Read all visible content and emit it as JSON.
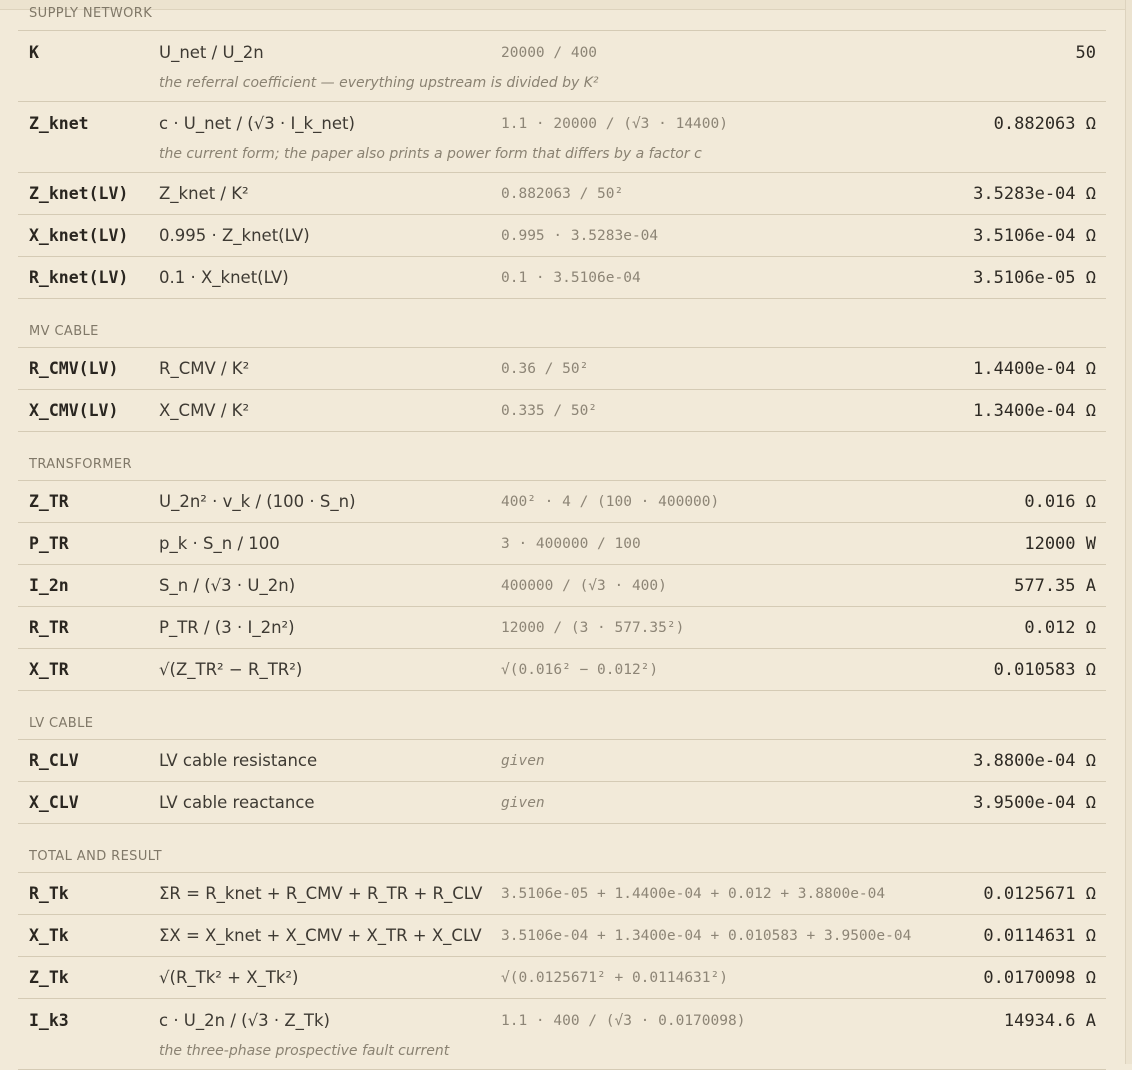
{
  "sections": {
    "supply": {
      "title": "SUPPLY NETWORK"
    },
    "mv": {
      "title": "MV CABLE"
    },
    "tr": {
      "title": "TRANSFORMER"
    },
    "lv": {
      "title": "LV CABLE"
    },
    "total": {
      "title": "TOTAL AND RESULT"
    }
  },
  "rows": {
    "K": {
      "symbol": "K",
      "formula": "U_net / U_2n",
      "substitution": "20000 / 400",
      "result": "50",
      "note": "the referral coefficient — everything upstream is divided by K²"
    },
    "Z_knet": {
      "symbol": "Z_knet",
      "formula": "c · U_net / (√3 · I_k_net)",
      "substitution": "1.1 · 20000 / (√3 · 14400)",
      "result": "0.882063 Ω",
      "note": "the current form; the paper also prints a power form that differs by a factor c"
    },
    "Z_knet_lv": {
      "symbol": "Z_knet(LV)",
      "formula": "Z_knet / K²",
      "substitution": "0.882063 / 50²",
      "result": "3.5283e-04 Ω"
    },
    "X_knet_lv": {
      "symbol": "X_knet(LV)",
      "formula": "0.995 · Z_knet(LV)",
      "substitution": "0.995 · 3.5283e-04",
      "result": "3.5106e-04 Ω"
    },
    "R_knet_lv": {
      "symbol": "R_knet(LV)",
      "formula": "0.1 · X_knet(LV)",
      "substitution": "0.1 · 3.5106e-04",
      "result": "3.5106e-05 Ω"
    },
    "R_CMV_lv": {
      "symbol": "R_CMV(LV)",
      "formula": "R_CMV / K²",
      "substitution": "0.36 / 50²",
      "result": "1.4400e-04 Ω"
    },
    "X_CMV_lv": {
      "symbol": "X_CMV(LV)",
      "formula": "X_CMV / K²",
      "substitution": "0.335 / 50²",
      "result": "1.3400e-04 Ω"
    },
    "Z_TR": {
      "symbol": "Z_TR",
      "formula": "U_2n² · v_k / (100 · S_n)",
      "substitution": "400² · 4 / (100 · 400000)",
      "result": "0.016 Ω"
    },
    "P_TR": {
      "symbol": "P_TR",
      "formula": "p_k · S_n / 100",
      "substitution": "3 · 400000 / 100",
      "result": "12000 W"
    },
    "I_2n": {
      "symbol": "I_2n",
      "formula": "S_n / (√3 · U_2n)",
      "substitution": "400000 / (√3 · 400)",
      "result": "577.35 A"
    },
    "R_TR": {
      "symbol": "R_TR",
      "formula": "P_TR / (3 · I_2n²)",
      "substitution": "12000 / (3 · 577.35²)",
      "result": "0.012 Ω"
    },
    "X_TR": {
      "symbol": "X_TR",
      "formula": "√(Z_TR² − R_TR²)",
      "substitution": "√(0.016² − 0.012²)",
      "result": "0.010583 Ω"
    },
    "R_CLV": {
      "symbol": "R_CLV",
      "formula": "LV cable resistance",
      "substitution": "given",
      "result": "3.8800e-04 Ω"
    },
    "X_CLV": {
      "symbol": "X_CLV",
      "formula": "LV cable reactance",
      "substitution": "given",
      "result": "3.9500e-04 Ω"
    },
    "R_Tk": {
      "symbol": "R_Tk",
      "formula": "ΣR = R_knet + R_CMV + R_TR + R_CLV",
      "substitution": "3.5106e-05 + 1.4400e-04 + 0.012 + 3.8800e-04",
      "result": "0.0125671 Ω"
    },
    "X_Tk": {
      "symbol": "X_Tk",
      "formula": "ΣX = X_knet + X_CMV + X_TR + X_CLV",
      "substitution": "3.5106e-04 + 1.3400e-04 + 0.010583 + 3.9500e-04",
      "result": "0.0114631 Ω"
    },
    "Z_Tk": {
      "symbol": "Z_Tk",
      "formula": "√(R_Tk² + X_Tk²)",
      "substitution": "√(0.0125671² + 0.0114631²)",
      "result": "0.0170098 Ω"
    },
    "I_k3": {
      "symbol": "I_k3",
      "formula": "c · U_2n / (√3 · Z_Tk)",
      "substitution": "1.1 · 400 / (√3 · 0.0170098)",
      "result": "14934.6 A",
      "note": "the three-phase prospective fault current"
    }
  }
}
